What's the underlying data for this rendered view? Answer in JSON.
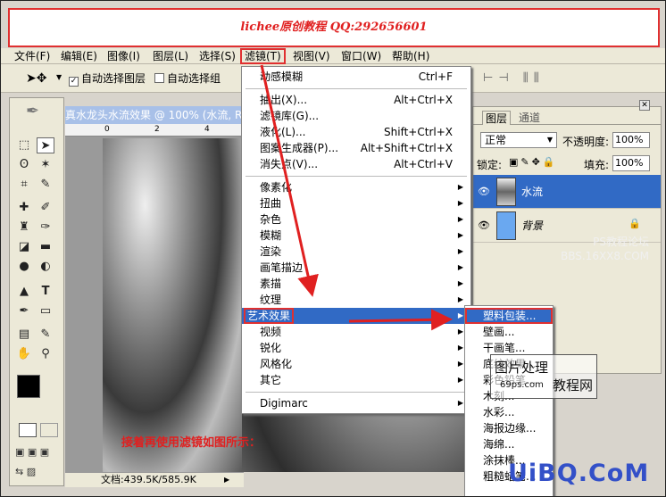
{
  "banner": {
    "text": "lichee原创教程 QQ:292656601"
  },
  "menubar": {
    "items": [
      "文件(F)",
      "编辑(E)",
      "图像(I)",
      "图层(L)",
      "选择(S)",
      "滤镜(T)",
      "视图(V)",
      "窗口(W)",
      "帮助(H)"
    ]
  },
  "options": {
    "auto_select_layer": "自动选择图层",
    "auto_select_group": "自动选择组"
  },
  "document": {
    "title": "真水龙头水流效果 @ 100% (水流, RG",
    "status": "文档:439.5K/585.9K",
    "ruler_marks": [
      "0",
      "2",
      "4"
    ]
  },
  "filter_menu": {
    "top_items": [
      {
        "label": "动感模糊",
        "shortcut": "Ctrl+F"
      },
      {
        "label": "抽出(X)...",
        "shortcut": "Alt+Ctrl+X"
      },
      {
        "label": "滤镜库(G)...",
        "shortcut": ""
      },
      {
        "label": "液化(L)...",
        "shortcut": "Shift+Ctrl+X"
      },
      {
        "label": "图案生成器(P)...",
        "shortcut": "Alt+Shift+Ctrl+X"
      },
      {
        "label": "消失点(V)...",
        "shortcut": "Alt+Ctrl+V"
      }
    ],
    "sub_items": [
      "像素化",
      "扭曲",
      "杂色",
      "模糊",
      "渲染",
      "画笔描边",
      "素描",
      "纹理",
      "艺术效果",
      "视频",
      "锐化",
      "风格化",
      "其它"
    ],
    "bottom_item": "Digimarc"
  },
  "art_submenu": {
    "items": [
      "塑料包装...",
      "壁画...",
      "干画笔...",
      "底纹效果...",
      "彩色铅笔...",
      "木刻...",
      "水彩...",
      "海报边缘...",
      "海绵...",
      "涂抹棒...",
      "粗糙蜡笔..."
    ]
  },
  "layers_panel": {
    "tabs": [
      "图层",
      "通道"
    ],
    "blend_mode": "正常",
    "opacity_label": "不透明度:",
    "opacity_value": "100%",
    "lock_label": "锁定:",
    "fill_label": "填充:",
    "fill_value": "100%",
    "layers": [
      {
        "name": "水流",
        "selected": true
      },
      {
        "name": "背景",
        "selected": false
      }
    ]
  },
  "annotation": {
    "text": "接着再使用滤镜如图所示："
  },
  "watermarks": {
    "ps_forum": "PS教程论坛",
    "bbs": "BBS.16XX8.COM",
    "box_line1": "图片处理",
    "box_line2": "教程网",
    "box_url": "69ps.com",
    "logo": "UiBQ.CoM"
  },
  "colors": {
    "accent_red": "#e02020",
    "selection_blue": "#316ac5",
    "logo_blue": "#3350c8"
  }
}
